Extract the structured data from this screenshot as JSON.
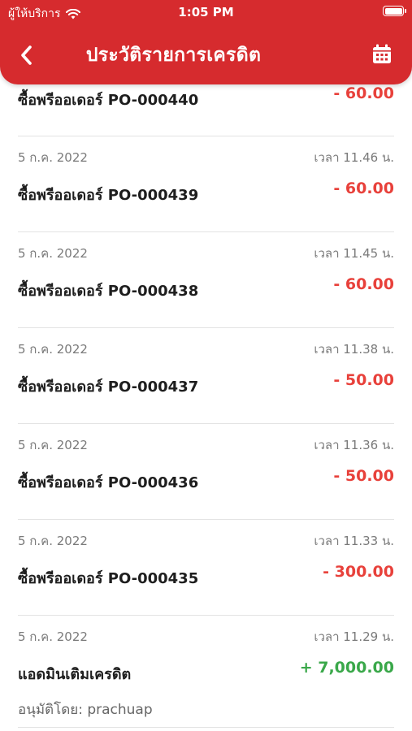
{
  "status_bar": {
    "carrier": "ผู้ให้บริการ",
    "time": "1:05 PM",
    "battery_level": 1.0
  },
  "header": {
    "title": "ประวัติรายการเครดิต",
    "back_icon": "chevron-left-icon",
    "calendar_icon": "calendar-icon"
  },
  "colors": {
    "header_bg": "#d62b2e",
    "debit": "#e8413b",
    "credit": "#3aa84a"
  },
  "transactions": [
    {
      "date": "",
      "time": "",
      "description": "ซื้อพรีออเดอร์ PO-000440",
      "amount": "- 60.00",
      "type": "debit"
    },
    {
      "date": "5 ก.ค. 2022",
      "time": "เวลา 11.46 น.",
      "description": "ซื้อพรีออเดอร์ PO-000439",
      "amount": "- 60.00",
      "type": "debit"
    },
    {
      "date": "5 ก.ค. 2022",
      "time": "เวลา 11.45 น.",
      "description": "ซื้อพรีออเดอร์ PO-000438",
      "amount": "- 60.00",
      "type": "debit"
    },
    {
      "date": "5 ก.ค. 2022",
      "time": "เวลา 11.38 น.",
      "description": "ซื้อพรีออเดอร์ PO-000437",
      "amount": "- 50.00",
      "type": "debit"
    },
    {
      "date": "5 ก.ค. 2022",
      "time": "เวลา 11.36 น.",
      "description": "ซื้อพรีออเดอร์ PO-000436",
      "amount": "- 50.00",
      "type": "debit"
    },
    {
      "date": "5 ก.ค. 2022",
      "time": "เวลา 11.33 น.",
      "description": "ซื้อพรีออเดอร์ PO-000435",
      "amount": "- 300.00",
      "type": "debit"
    },
    {
      "date": "5 ก.ค. 2022",
      "time": "เวลา 11.29 น.",
      "description": "แอดมินเติมเครดิต",
      "amount": "+ 7,000.00",
      "type": "credit",
      "approver": "อนุมัติโดย: prachuap"
    }
  ]
}
